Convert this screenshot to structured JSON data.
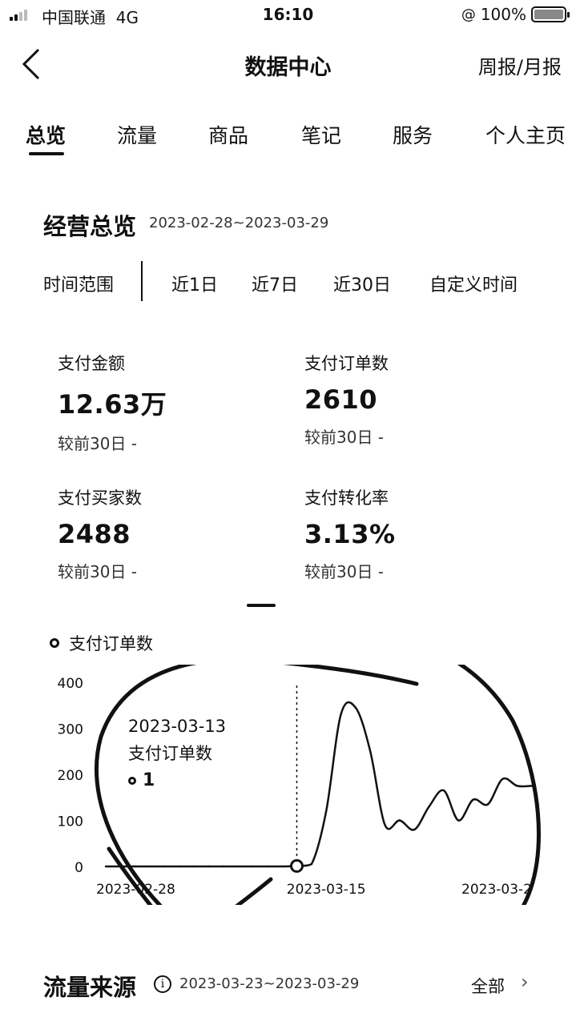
{
  "status_bar": {
    "carrier": "中国联通",
    "network": "4G",
    "time": "16:10",
    "battery": "100%"
  },
  "nav": {
    "back_icon": "chevron-left-icon",
    "title": "数据中心",
    "report_link": "周报/月报"
  },
  "tabs": [
    {
      "label": "总览",
      "active": true
    },
    {
      "label": "流量",
      "active": false
    },
    {
      "label": "商品",
      "active": false
    },
    {
      "label": "笔记",
      "active": false
    },
    {
      "label": "服务",
      "active": false
    },
    {
      "label": "个人主页",
      "active": false
    }
  ],
  "overview": {
    "title": "经营总览",
    "date_range": "2023-02-28~2023-03-29"
  },
  "time_range": {
    "label": "时间范围",
    "options": [
      "近1日",
      "近7日",
      "近30日",
      "自定义时间"
    ]
  },
  "metrics": [
    {
      "label": "支付金额",
      "value": "12.63万",
      "compare": "较前30日 -"
    },
    {
      "label": "支付订单数",
      "value": "2610",
      "compare": "较前30日 -"
    },
    {
      "label": "支付买家数",
      "value": "2488",
      "compare": "较前30日 -"
    },
    {
      "label": "支付转化率",
      "value": "3.13%",
      "compare": "较前30日 -"
    }
  ],
  "chart_legend": "支付订单数",
  "tooltip": {
    "date": "2023-03-13",
    "series": "支付订单数",
    "value": "1"
  },
  "chart_data": {
    "type": "line",
    "title": "",
    "series": [
      {
        "name": "支付订单数",
        "x": [
          "2023-02-28",
          "2023-03-01",
          "2023-03-02",
          "2023-03-03",
          "2023-03-04",
          "2023-03-05",
          "2023-03-06",
          "2023-03-07",
          "2023-03-08",
          "2023-03-09",
          "2023-03-10",
          "2023-03-11",
          "2023-03-12",
          "2023-03-13",
          "2023-03-14",
          "2023-03-15",
          "2023-03-16",
          "2023-03-17",
          "2023-03-18",
          "2023-03-19",
          "2023-03-20",
          "2023-03-21",
          "2023-03-22",
          "2023-03-23",
          "2023-03-24",
          "2023-03-25",
          "2023-03-26",
          "2023-03-27",
          "2023-03-28",
          "2023-03-29"
        ],
        "values": [
          0,
          0,
          0,
          0,
          0,
          0,
          0,
          0,
          0,
          0,
          0,
          0,
          0,
          1,
          5,
          120,
          330,
          345,
          250,
          90,
          100,
          80,
          130,
          165,
          100,
          145,
          135,
          190,
          175,
          175
        ]
      }
    ],
    "x_tick_labels": [
      "2023-02-28",
      "2023-03-15",
      "2023-03-2"
    ],
    "y_tick_labels": [
      "400",
      "300",
      "200",
      "100",
      "0"
    ],
    "ylim": [
      0,
      400
    ],
    "highlight_x": "2023-03-13",
    "grid": false,
    "annotation_color": "#111111"
  },
  "traffic_source": {
    "title": "流量来源",
    "info_icon": "info-icon",
    "date_range": "2023-03-23~2023-03-29",
    "all_label": "全部",
    "chevron_icon": "chevron-right-icon"
  }
}
